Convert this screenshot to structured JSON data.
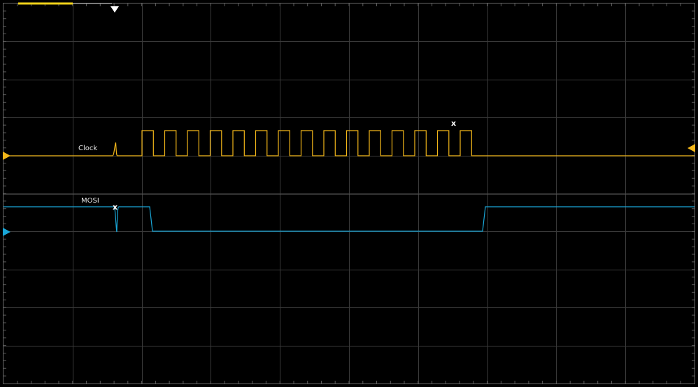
{
  "screen": {
    "background": "#000000",
    "grid_color": "#3a3a3a",
    "minor_tick_color": "#5a5a5a",
    "frame_color": "#6a6a6a"
  },
  "channels": [
    {
      "name": "Clock",
      "color": "#f2b619",
      "ground_marker": "left-triangle",
      "trigger_marker": "right-triangle"
    },
    {
      "name": "MOSI",
      "color": "#19a7d8",
      "ground_marker": "left-triangle"
    }
  ],
  "markers": {
    "trigger_position_icon": "down-triangle-icon",
    "trigger_position_color": "#ffffff",
    "cursor_glyph": "x",
    "memory_bar_color": "#f2d21a"
  }
}
